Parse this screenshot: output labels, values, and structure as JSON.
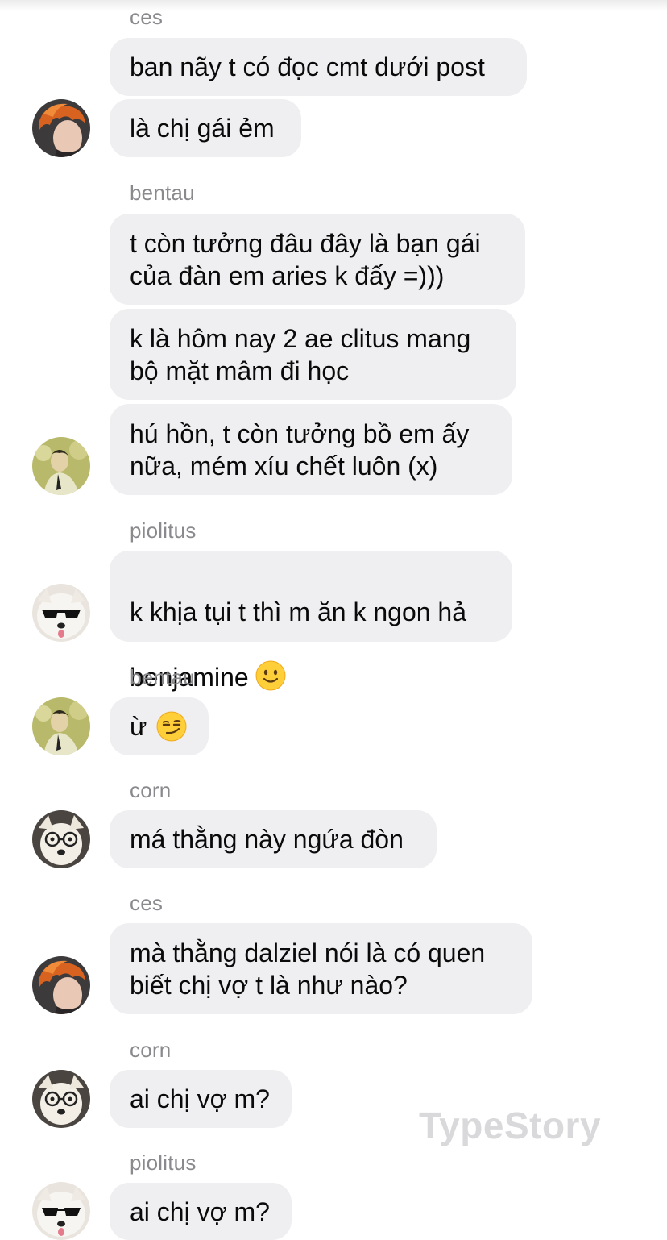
{
  "app": "TypeStory",
  "messages": {
    "s1": "ces",
    "b1": "ban nãy t có đọc cmt dưới post",
    "b2": "là chị gái ẻm",
    "s2": "bentau",
    "b3": "t còn tưởng đâu đây là bạn gái\ncủa đàn em aries k đấy =)))",
    "b4": "k là hôm nay 2 ae clitus mang\nbộ mặt mâm đi học",
    "b5": "hú hồn, t còn tưởng bồ em ấy\nnữa, mém xíu chết luôn (x)",
    "s3": "piolitus",
    "b6_line1": "k khịa tụi t thì m ăn k ngon hả",
    "b6_line2": "benjamine",
    "s4": "bentau",
    "b7": "ừ",
    "s5": "corn",
    "b8": "má thằng này ngứa đòn",
    "s6": "ces",
    "b9": "mà thằng dalziel nói là có quen\nbiết chị vợ t là như nào?",
    "s7": "corn",
    "b10": "ai chị vợ m?",
    "s8": "piolitus",
    "b11": "ai chị vợ m?"
  },
  "avatars": {
    "ces": "orange-hair-avatar",
    "bentau": "vintage-portrait-avatar",
    "piolitus": "dog-sunglasses-avatar",
    "corn": "dog-glasses-avatar"
  },
  "emojis": {
    "b6": "slightly-smiling-face",
    "b7": "smirking-face"
  },
  "colors": {
    "bubble": "#efeff1",
    "sender": "#8a8a8e",
    "text": "#0a0a0a",
    "watermark": "#d9d9db"
  },
  "watermark": "TypeStory"
}
